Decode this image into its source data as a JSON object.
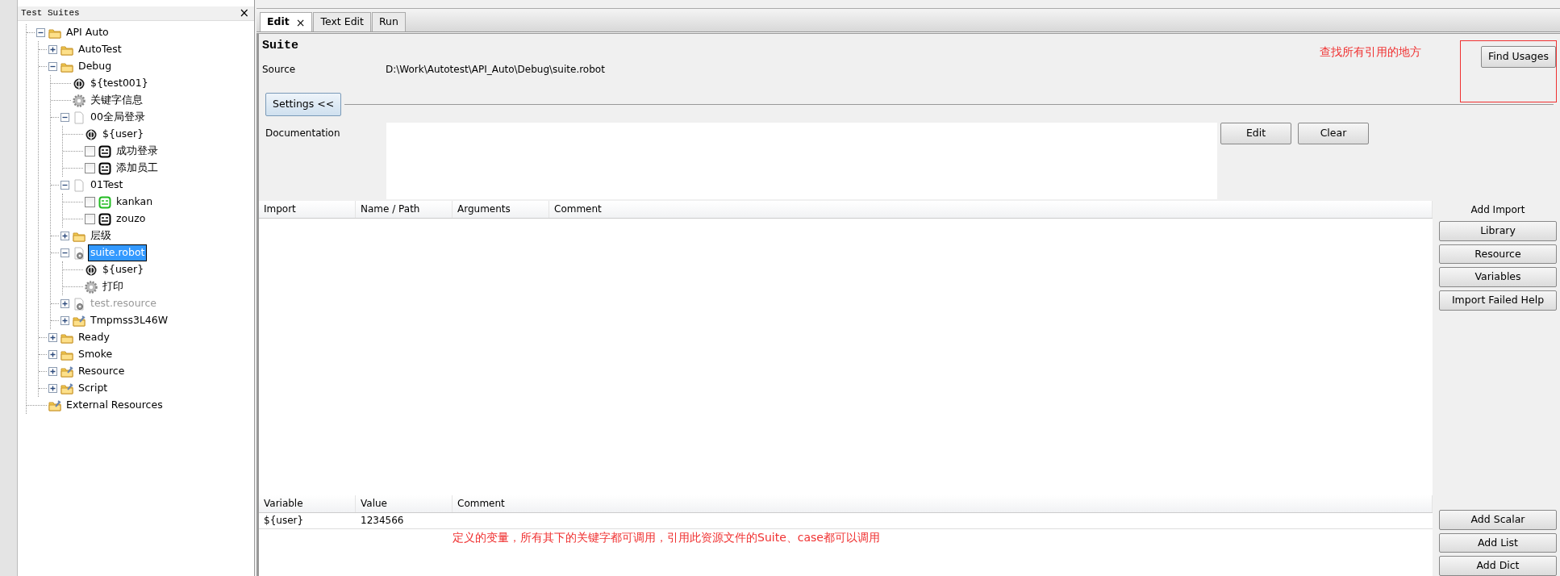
{
  "tree_panel": {
    "title": "Test Suites",
    "close": "×"
  },
  "tree": [
    {
      "label": "API Auto",
      "kind": "folder",
      "expanded": true,
      "selected": false,
      "children": [
        {
          "label": "AutoTest",
          "kind": "folder",
          "expanded": false,
          "selected": false
        },
        {
          "label": "Debug",
          "kind": "folder",
          "expanded": true,
          "selected": false,
          "children": [
            {
              "label": "${test001}",
              "kind": "variable",
              "selected": false
            },
            {
              "label": "关键字信息",
              "kind": "keyword",
              "selected": false
            },
            {
              "label": "00全局登录",
              "kind": "file",
              "expanded": true,
              "selected": false,
              "children": [
                {
                  "label": "${user}",
                  "kind": "variable",
                  "selected": false
                },
                {
                  "label": "成功登录",
                  "kind": "testcase",
                  "checked": false,
                  "color": "#000000",
                  "selected": false
                },
                {
                  "label": "添加员工",
                  "kind": "testcase",
                  "checked": false,
                  "color": "#000000",
                  "selected": false
                }
              ]
            },
            {
              "label": "01Test",
              "kind": "file",
              "expanded": true,
              "selected": false,
              "children": [
                {
                  "label": "kankan",
                  "kind": "testcase",
                  "checked": false,
                  "color": "#22bb22",
                  "selected": false
                },
                {
                  "label": "zouzo",
                  "kind": "testcase",
                  "checked": false,
                  "color": "#000000",
                  "selected": false
                }
              ]
            },
            {
              "label": "层级",
              "kind": "folder",
              "expanded": false,
              "selected": false
            },
            {
              "label": "suite.robot",
              "kind": "resource",
              "expanded": true,
              "selected": true,
              "children": [
                {
                  "label": "${user}",
                  "kind": "variable",
                  "selected": false
                },
                {
                  "label": "打印",
                  "kind": "keyword",
                  "selected": false
                }
              ]
            },
            {
              "label": "test.resource",
              "kind": "resource",
              "expanded": false,
              "disabled": true,
              "selected": false
            },
            {
              "label": "Tmpmss3L46W",
              "kind": "resfolder",
              "expanded": false,
              "selected": false
            }
          ]
        },
        {
          "label": "Ready",
          "kind": "folder",
          "expanded": false,
          "selected": false
        },
        {
          "label": "Smoke",
          "kind": "folder",
          "expanded": false,
          "selected": false
        },
        {
          "label": "Resource",
          "kind": "resfolder",
          "expanded": false,
          "selected": false
        },
        {
          "label": "Script",
          "kind": "resfolder",
          "expanded": false,
          "selected": false
        }
      ]
    },
    {
      "label": "External Resources",
      "kind": "resfolder",
      "selected": false
    }
  ],
  "tabs": [
    {
      "label": "Edit",
      "selected": true,
      "close": "×"
    },
    {
      "label": "Text Edit",
      "selected": false
    },
    {
      "label": "Run",
      "selected": false
    }
  ],
  "editor": {
    "title": "Suite",
    "source_label": "Source",
    "source": "D:\\Work\\Autotest\\API_Auto\\Debug\\suite.robot",
    "note": "查找所有引用的地方",
    "find_usages": "Find Usages",
    "settings_button": "Settings <<",
    "documentation_label": "Documentation",
    "doc_buttons": [
      "Edit",
      "Clear"
    ]
  },
  "imports": {
    "columns": [
      "Import",
      "Name / Path",
      "Arguments",
      "Comment"
    ],
    "side_title": "Add Import",
    "buttons": [
      "Library",
      "Resource",
      "Variables",
      "Import Failed Help"
    ]
  },
  "variables": {
    "columns": [
      "Variable",
      "Value",
      "Comment"
    ],
    "rows": [
      {
        "variable": "${user}",
        "value": "1234566"
      }
    ],
    "note": "定义的变量，所有其下的关键字都可调用，引用此资源文件的Suite、case都可以调用",
    "buttons": [
      "Add Scalar",
      "Add List",
      "Add Dict"
    ]
  }
}
